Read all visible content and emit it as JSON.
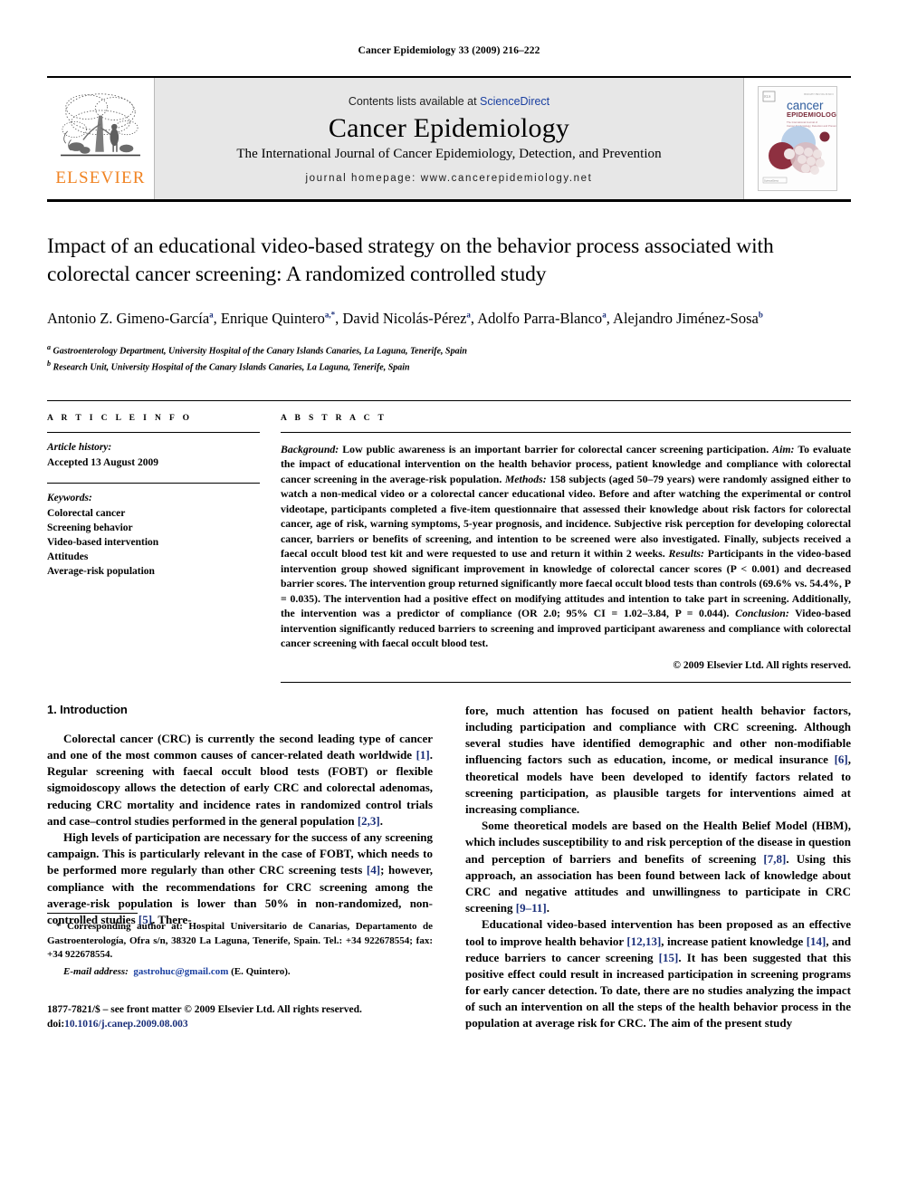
{
  "running_head": "Cancer Epidemiology 33 (2009) 216–222",
  "masthead": {
    "publisher_name": "ELSEVIER",
    "contents_prefix": "Contents lists available at ",
    "contents_link": "ScienceDirect",
    "journal_title": "Cancer Epidemiology",
    "journal_subtitle": "The International Journal of Cancer Epidemiology, Detection, and Prevention",
    "journal_homepage": "journal homepage: www.cancerepidemiology.net",
    "cover_title_line1": "cancer",
    "cover_title_line2": "EPIDEMIOLOGY",
    "cover_sub": "The International Journal of Cancer Epidemiology, Detection and Prevention"
  },
  "article": {
    "title": "Impact of an educational video-based strategy on the behavior process associated with colorectal cancer screening: A randomized controlled study",
    "authors": [
      {
        "name": "Antonio Z. Gimeno-García",
        "marks": "a"
      },
      {
        "name": "Enrique Quintero",
        "marks": "a,*"
      },
      {
        "name": "David Nicolás-Pérez",
        "marks": "a"
      },
      {
        "name": "Adolfo Parra-Blanco",
        "marks": "a"
      },
      {
        "name": "Alejandro Jiménez-Sosa",
        "marks": "b"
      }
    ],
    "affiliations": [
      {
        "mark": "a",
        "text": "Gastroenterology Department, University Hospital of the Canary Islands Canaries, La Laguna, Tenerife, Spain"
      },
      {
        "mark": "b",
        "text": "Research Unit, University Hospital of the Canary Islands Canaries, La Laguna, Tenerife, Spain"
      }
    ]
  },
  "article_info": {
    "heading": "A R T I C L E  I N F O",
    "history_label": "Article history:",
    "history_value": "Accepted 13 August 2009",
    "keywords_label": "Keywords:",
    "keywords": [
      "Colorectal cancer",
      "Screening behavior",
      "Video-based intervention",
      "Attitudes",
      "Average-risk population"
    ]
  },
  "abstract": {
    "heading": "A B S T R A C T",
    "segments": [
      {
        "italic": "Background:",
        "text": " Low public awareness is an important barrier for colorectal cancer screening participation. "
      },
      {
        "italic": "Aim:",
        "text": " To evaluate the impact of educational intervention on the health behavior process, patient knowledge and compliance with colorectal cancer screening in the average-risk population. "
      },
      {
        "italic": "Methods:",
        "text": " 158 subjects (aged 50–79 years) were randomly assigned either to watch a non-medical video or a colorectal cancer educational video. Before and after watching the experimental or control videotape, participants completed a five-item questionnaire that assessed their knowledge about risk factors for colorectal cancer, age of risk, warning symptoms, 5-year prognosis, and incidence. Subjective risk perception for developing colorectal cancer, barriers or benefits of screening, and intention to be screened were also investigated. Finally, subjects received a faecal occult blood test kit and were requested to use and return it within 2 weeks. "
      },
      {
        "italic": "Results:",
        "text": " Participants in the video-based intervention group showed significant improvement in knowledge of colorectal cancer scores (P < 0.001) and decreased barrier scores. The intervention group returned significantly more faecal occult blood tests than controls (69.6% vs. 54.4%, P = 0.035). The intervention had a positive effect on modifying attitudes and intention to take part in screening. Additionally, the intervention was a predictor of compliance (OR 2.0; 95% CI = 1.02–3.84, P = 0.044). "
      },
      {
        "italic": "Conclusion:",
        "text": " Video-based intervention significantly reduced barriers to screening and improved participant awareness and compliance with colorectal cancer screening with faecal occult blood test."
      }
    ],
    "copyright": "© 2009 Elsevier Ltd. All rights reserved."
  },
  "body": {
    "section_title": "1. Introduction",
    "left_paragraphs": [
      "Colorectal cancer (CRC) is currently the second leading type of cancer and one of the most common causes of cancer-related death worldwide [1]. Regular screening with faecal occult blood tests (FOBT) or flexible sigmoidoscopy allows the detection of early CRC and colorectal adenomas, reducing CRC mortality and incidence rates in randomized control trials and case–control studies performed in the general population [2,3].",
      "High levels of participation are necessary for the success of any screening campaign. This is particularly relevant in the case of FOBT, which needs to be performed more regularly than other CRC screening tests [4]; however, compliance with the recommendations for CRC screening among the average-risk population is lower than 50% in non-randomized, non-controlled studies [5]. There-"
    ],
    "right_paragraphs": [
      "fore, much attention has focused on patient health behavior factors, including participation and compliance with CRC screening. Although several studies have identified demographic and other non-modifiable influencing factors such as education, income, or medical insurance [6], theoretical models have been developed to identify factors related to screening participation, as plausible targets for interventions aimed at increasing compliance.",
      "Some theoretical models are based on the Health Belief Model (HBM), which includes susceptibility to and risk perception of the disease in question and perception of barriers and benefits of screening [7,8]. Using this approach, an association has been found between lack of knowledge about CRC and negative attitudes and unwillingness to participate in CRC screening [9–11].",
      "Educational video-based intervention has been proposed as an effective tool to improve health behavior [12,13], increase patient knowledge [14], and reduce barriers to cancer screening [15]. It has been suggested that this positive effect could result in increased participation in screening programs for early cancer detection. To date, there are no studies analyzing the impact of such an intervention on all the steps of the health behavior process in the population at average risk for CRC. The aim of the present study"
    ]
  },
  "footnotes": {
    "corresponding": "* Corresponding author at: Hospital Universitario de Canarias, Departamento de Gastroenterología, Ofra s/n, 38320 La Laguna, Tenerife, Spain. Tel.: +34 922678554; fax: +34 922678554.",
    "email_label": "E-mail address:",
    "email_value": "gastrohuc@gmail.com",
    "email_suffix": " (E. Quintero).",
    "issn_line": "1877-7821/$ – see front matter © 2009 Elsevier Ltd. All rights reserved.",
    "doi_label": "doi:",
    "doi_value": "10.1016/j.canep.2009.08.003"
  },
  "colors": {
    "link_blue": "#1a3fa0",
    "ref_blue": "#1a2f7a",
    "elsevier_orange": "#f08322",
    "masthead_grey": "#e7e7e7"
  }
}
